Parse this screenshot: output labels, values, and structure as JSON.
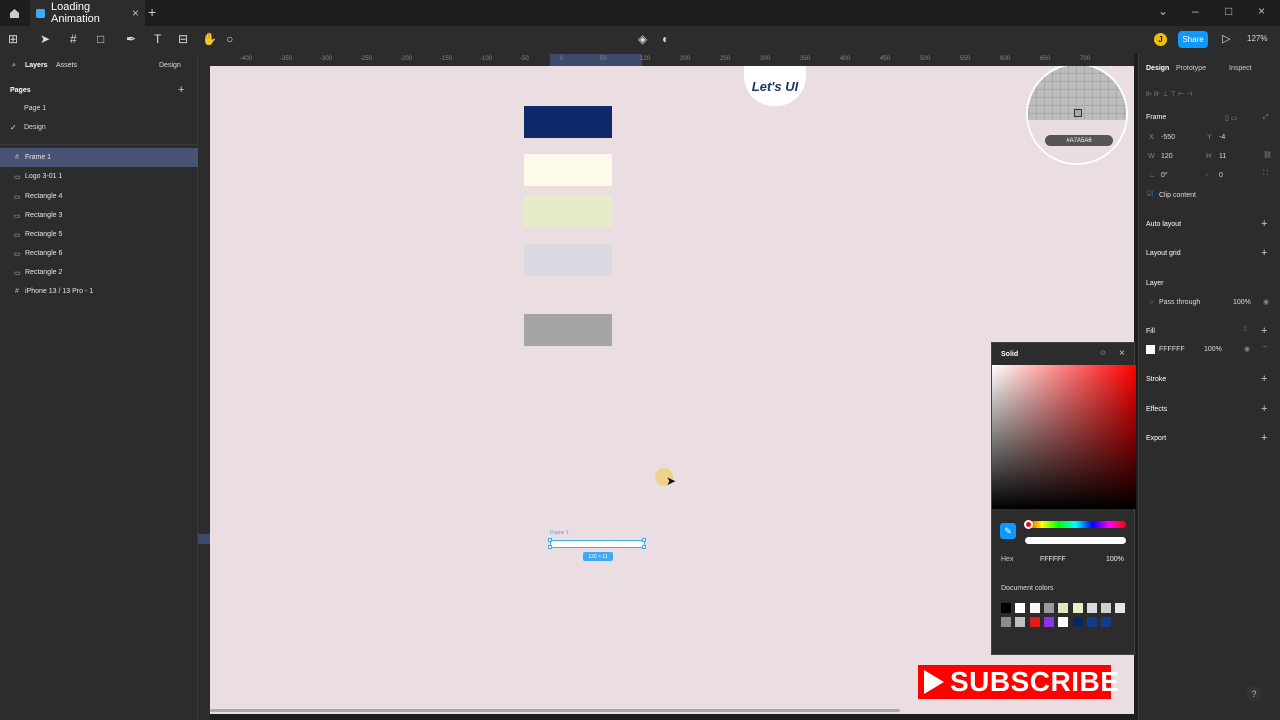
{
  "tabbar": {
    "tab_title": "Loading Animation"
  },
  "toolbar": {
    "avatar_initial": "J",
    "share_label": "Share",
    "zoom_label": "127%"
  },
  "left_panel": {
    "tabs": [
      "Layers",
      "Assets"
    ],
    "page_dropdown": "Design",
    "pages_title": "Pages",
    "pages": [
      "Page 1",
      "Design"
    ],
    "layers": [
      "Frame 1",
      "Logo 3-01 1",
      "Rectangle 4",
      "Rectangle 3",
      "Rectangle 5",
      "Rectangle 6",
      "Rectangle 2",
      "iPhone 13 / 13 Pro - 1"
    ]
  },
  "ruler": {
    "labels": [
      "-400",
      "-350",
      "-300",
      "-250",
      "-200",
      "-150",
      "-100",
      "-50",
      "0",
      "50",
      "120",
      "200",
      "250",
      "300",
      "350",
      "400",
      "450",
      "500",
      "550",
      "600",
      "650",
      "700"
    ]
  },
  "canvas": {
    "logo_text": "Let's UI",
    "frame_label": "Frame 1",
    "size_tag": "120 × 11",
    "magnifier_hex": "#A7A5A6",
    "rect_colors": [
      "#0f2a6b",
      "#fdfaea",
      "#e6ecc8",
      "#dcd8e2",
      "#a5a5a5"
    ]
  },
  "color_picker": {
    "mode": "Solid",
    "hex_label": "Hex",
    "hex_value": "FFFFFF",
    "opacity": "100%",
    "doc_colors_label": "Document colors",
    "swatches_row1": [
      "#000000",
      "#ffffff",
      "#f5f5f5",
      "#9a9a9a",
      "#dfe8bd",
      "#e8efc9",
      "#d9dbe3",
      "#cfcfcf",
      "#e6e6e6"
    ],
    "swatches_row2": [
      "#8c8c8c",
      "#bfbfbf",
      "#e31b1b",
      "#8a35e8",
      "#ffffff",
      "#0b2566",
      "#123b8c",
      "#143a90"
    ]
  },
  "right_panel": {
    "tabs": [
      "Design",
      "Prototype",
      "Inspect"
    ],
    "frame_label": "Frame",
    "x_label": "X",
    "x": "-550",
    "y_label": "Y",
    "y": "-4",
    "w_label": "W",
    "w": "120",
    "h_label": "H",
    "h": "11",
    "rotation": "0°",
    "radius": "0",
    "clip_content": "Clip content",
    "auto_layout": "Auto layout",
    "layout_grid": "Layout grid",
    "layer_title": "Layer",
    "blend": "Pass through",
    "layer_opacity": "100%",
    "fill_title": "Fill",
    "fill_hex": "FFFFFF",
    "fill_opacity": "100%",
    "stroke": "Stroke",
    "effects": "Effects",
    "export": "Export"
  },
  "overlay": {
    "subscribe": "SUBSCRIBE"
  },
  "help": "?"
}
